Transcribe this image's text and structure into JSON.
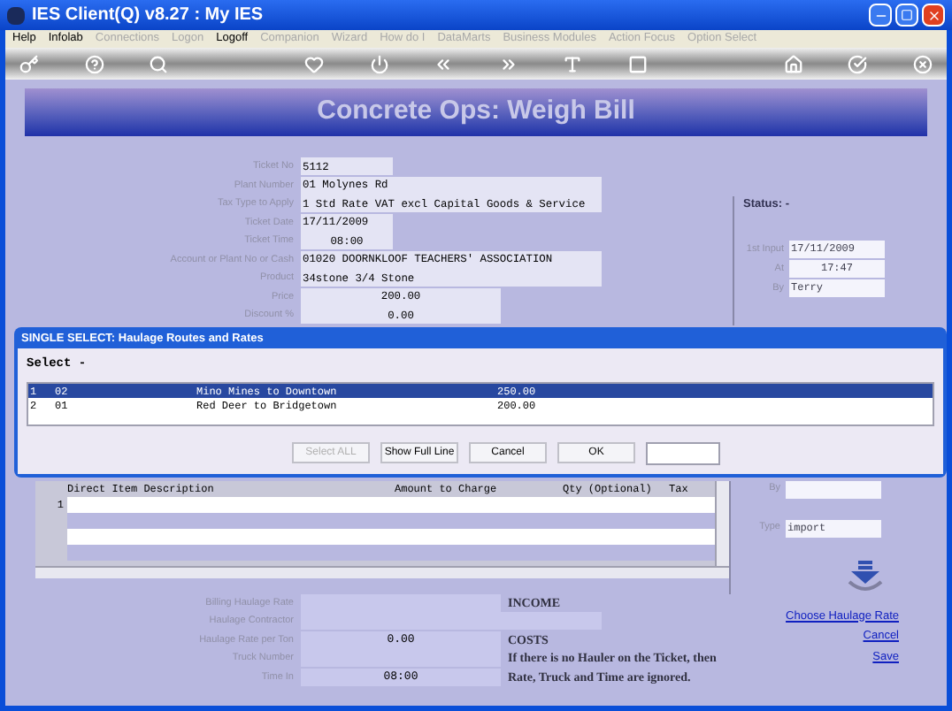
{
  "window": {
    "title": "IES Client(Q) v8.27 : My IES"
  },
  "menu": [
    {
      "label": "Help",
      "disabled": false
    },
    {
      "label": "Infolab",
      "disabled": false
    },
    {
      "label": "Connections",
      "disabled": true
    },
    {
      "label": "Logon",
      "disabled": true
    },
    {
      "label": "Logoff",
      "disabled": false
    },
    {
      "label": "Companion",
      "disabled": true
    },
    {
      "label": "Wizard",
      "disabled": true
    },
    {
      "label": "How do I",
      "disabled": true
    },
    {
      "label": "DataMarts",
      "disabled": true
    },
    {
      "label": "Business Modules",
      "disabled": true
    },
    {
      "label": "Action Focus",
      "disabled": true
    },
    {
      "label": "Option Select",
      "disabled": true
    }
  ],
  "form": {
    "title": "Concrete Ops: Weigh Bill",
    "fields": [
      {
        "label": "Ticket No",
        "value": "5112"
      },
      {
        "label": "Plant Number",
        "value": "01 Molynes Rd"
      },
      {
        "label": "Tax Type to Apply",
        "value": "1 Std Rate VAT excl Capital Goods & Service"
      },
      {
        "label": "Ticket Date",
        "value": "17/11/2009"
      },
      {
        "label": "Ticket Time",
        "value": "08:00"
      },
      {
        "label": "Account or Plant No or Cash",
        "value": "01020 DOORNKLOOF TEACHERS' ASSOCIATION"
      },
      {
        "label": "Product",
        "value": "34stone 3/4 Stone"
      },
      {
        "label": "Price",
        "value": "200.00"
      },
      {
        "label": "Discount %",
        "value": "0.00"
      }
    ],
    "status": {
      "label": "Status: -"
    },
    "audit": [
      {
        "label": "1st Input",
        "value": "17/11/2009"
      },
      {
        "label": "At",
        "value": "17:47"
      },
      {
        "label": "By",
        "value": "Terry"
      }
    ],
    "grid": {
      "columns": [
        "Direct Item Description",
        "Amount to Charge",
        "Qty (Optional)",
        "Tax"
      ],
      "rows": [
        {
          "number": "1"
        },
        {},
        {},
        {}
      ]
    },
    "audit2": [
      {
        "label": "By"
      },
      {
        "label": "Type",
        "value": "import"
      }
    ],
    "haulage": [
      {
        "label": "Billing Haulage Rate",
        "note": "INCOME"
      },
      {
        "label": "Haulage Contractor"
      },
      {
        "label": "Haulage Rate per Ton",
        "value": "0.00",
        "note": "COSTS"
      },
      {
        "label": "Truck Number",
        "note": "If there is no Hauler on the Ticket, then"
      },
      {
        "label": "Time In",
        "value": "08:00",
        "note": "Rate, Truck and Time are ignored."
      }
    ],
    "links": [
      "Choose Haulage Rate",
      "Cancel",
      "Save"
    ]
  },
  "dialog": {
    "title": "SINGLE SELECT: Haulage Routes and Rates",
    "prompt": "Select -",
    "rows": [
      {
        "index": "1",
        "code": "02",
        "route": "Mino Mines to Downtown",
        "rate": "250.00",
        "selected": true
      },
      {
        "index": "2",
        "code": "01",
        "route": "Red Deer to Bridgetown",
        "rate": "200.00",
        "selected": false
      }
    ],
    "buttons": [
      {
        "label": "Select ALL",
        "disabled": true
      },
      {
        "label": "Show Full Line",
        "disabled": false
      },
      {
        "label": "Cancel",
        "disabled": false
      },
      {
        "label": "OK",
        "disabled": false
      }
    ]
  }
}
